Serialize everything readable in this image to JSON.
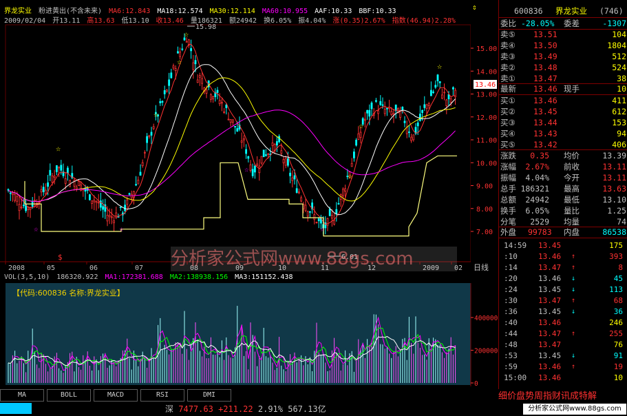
{
  "colors": {
    "up": "#ff3232",
    "down": "#00ffff",
    "ma5": "#ffffff",
    "ma10": "#ffff00",
    "ma30": "#ff00ff",
    "ma60": "#00ff00",
    "price": "#ff3232",
    "neutral": "#c0c0c0"
  },
  "header": {
    "stock_name": "界龙实业",
    "indicator_name": "粉进黄出(不含未来)",
    "ma5": "MA6:12.843",
    "ma18": "MA18:12.574",
    "ma30": "MA30:12.114",
    "ma60": "MA60:10.955",
    "aaf": "AAF:10.33",
    "bbf": "BBF:10.33",
    "date": "2009/02/04",
    "open": "开13.11",
    "high": "高13.63",
    "low": "低13.10",
    "close": "收13.46",
    "volume": "量186321",
    "amount": "额24942",
    "turnover": "换6.05%",
    "amplitude": "振4.04%",
    "change": "涨(0.35)2.67%",
    "index": "指数(46.94)2.28%"
  },
  "chart": {
    "high_label": "15.98",
    "low_label": "6.01",
    "price_axis": [
      "15.00",
      "14.00",
      "13.00",
      "12.00",
      "11.00",
      "10.00",
      "9.00",
      "8.00",
      "7.00"
    ],
    "current_price": "13.46",
    "month_labels": [
      "2008",
      "05",
      "06",
      "07",
      "08",
      "09",
      "10",
      "11",
      "12",
      "2009",
      "02"
    ],
    "period_label": "日线",
    "watermark": "分析家公式网www.88gs.com"
  },
  "volume": {
    "title": "VOL(3,5,10)",
    "vol": "186320.922",
    "ma1": "MA1:172381.688",
    "ma2": "MA2:138938.156",
    "ma3": "MA3:151152.438",
    "code_label": "【代码:600836 名称:界龙实业】",
    "axis": [
      "400000",
      "200000",
      "0"
    ]
  },
  "tabs": [
    "MA",
    "BOLL",
    "MACD",
    "RSI",
    "DMI"
  ],
  "status": {
    "market": "深",
    "index": "7477.63",
    "change": "+211.22",
    "pct": "2.91%",
    "amount": "567.13亿"
  },
  "quote": {
    "code": "600836",
    "name": "界龙实业",
    "seq": "(746)",
    "weibi_label": "委比",
    "weibi": "-28.05%",
    "weicha_label": "委差",
    "weicha": "-1307",
    "sell": [
      {
        "label": "卖⑤",
        "price": "13.51",
        "vol": "104"
      },
      {
        "label": "卖④",
        "price": "13.50",
        "vol": "1804"
      },
      {
        "label": "卖③",
        "price": "13.49",
        "vol": "512"
      },
      {
        "label": "卖②",
        "price": "13.48",
        "vol": "524"
      },
      {
        "label": "卖①",
        "price": "13.47",
        "vol": "38"
      }
    ],
    "latest_label": "最新",
    "latest": "13.46",
    "xianshou_label": "现手",
    "xianshou": "10",
    "buy": [
      {
        "label": "买①",
        "price": "13.46",
        "vol": "411"
      },
      {
        "label": "买②",
        "price": "13.45",
        "vol": "612"
      },
      {
        "label": "买③",
        "price": "13.44",
        "vol": "153"
      },
      {
        "label": "买④",
        "price": "13.43",
        "vol": "94"
      },
      {
        "label": "买⑤",
        "price": "13.42",
        "vol": "406"
      }
    ],
    "stats": [
      {
        "l1": "涨跌",
        "v1": "0.35",
        "l2": "均价",
        "v2": "13.39"
      },
      {
        "l1": "涨幅",
        "v1": "2.67%",
        "l2": "前收",
        "v2": "13.11"
      },
      {
        "l1": "振幅",
        "v1": "4.04%",
        "l2": "今开",
        "v2": "13.11"
      },
      {
        "l1": "总手",
        "v1": "186321",
        "l2": "最高",
        "v2": "13.63"
      },
      {
        "l1": "总额",
        "v1": "24942",
        "l2": "最低",
        "v2": "13.10"
      },
      {
        "l1": "换手",
        "v1": "6.05%",
        "l2": "量比",
        "v2": "1.25"
      },
      {
        "l1": "分笔",
        "v1": "2529",
        "l2": "均量",
        "v2": "74"
      }
    ],
    "waipan_label": "外盘",
    "waipan": "99783",
    "neipan_label": "内盘",
    "neipan": "86538"
  },
  "ticks": [
    {
      "t": "14:59",
      "p": "13.45",
      "a": "",
      "v": "175"
    },
    {
      "t": ":10",
      "p": "13.46",
      "a": "↑",
      "v": "393"
    },
    {
      "t": ":14",
      "p": "13.47",
      "a": "↑",
      "v": "8"
    },
    {
      "t": ":20",
      "p": "13.46",
      "a": "↓",
      "v": "45"
    },
    {
      "t": ":24",
      "p": "13.45",
      "a": "↓",
      "v": "113"
    },
    {
      "t": ":30",
      "p": "13.47",
      "a": "↑",
      "v": "68"
    },
    {
      "t": ":36",
      "p": "13.45",
      "a": "↓",
      "v": "36"
    },
    {
      "t": ":40",
      "p": "13.46",
      "a": "",
      "v": "246"
    },
    {
      "t": ":44",
      "p": "13.47",
      "a": "↑",
      "v": "255"
    },
    {
      "t": ":48",
      "p": "13.47",
      "a": "",
      "v": "76"
    },
    {
      "t": ":53",
      "p": "13.45",
      "a": "↓",
      "v": "91"
    },
    {
      "t": ":59",
      "p": "13.46",
      "a": "↑",
      "v": "19"
    },
    {
      "t": "15:00",
      "p": "13.46",
      "a": "",
      "v": "10"
    }
  ],
  "right_tabs": "细价盘势周指财讯成特解",
  "brand": "分析家公式网www.88gs.com"
}
